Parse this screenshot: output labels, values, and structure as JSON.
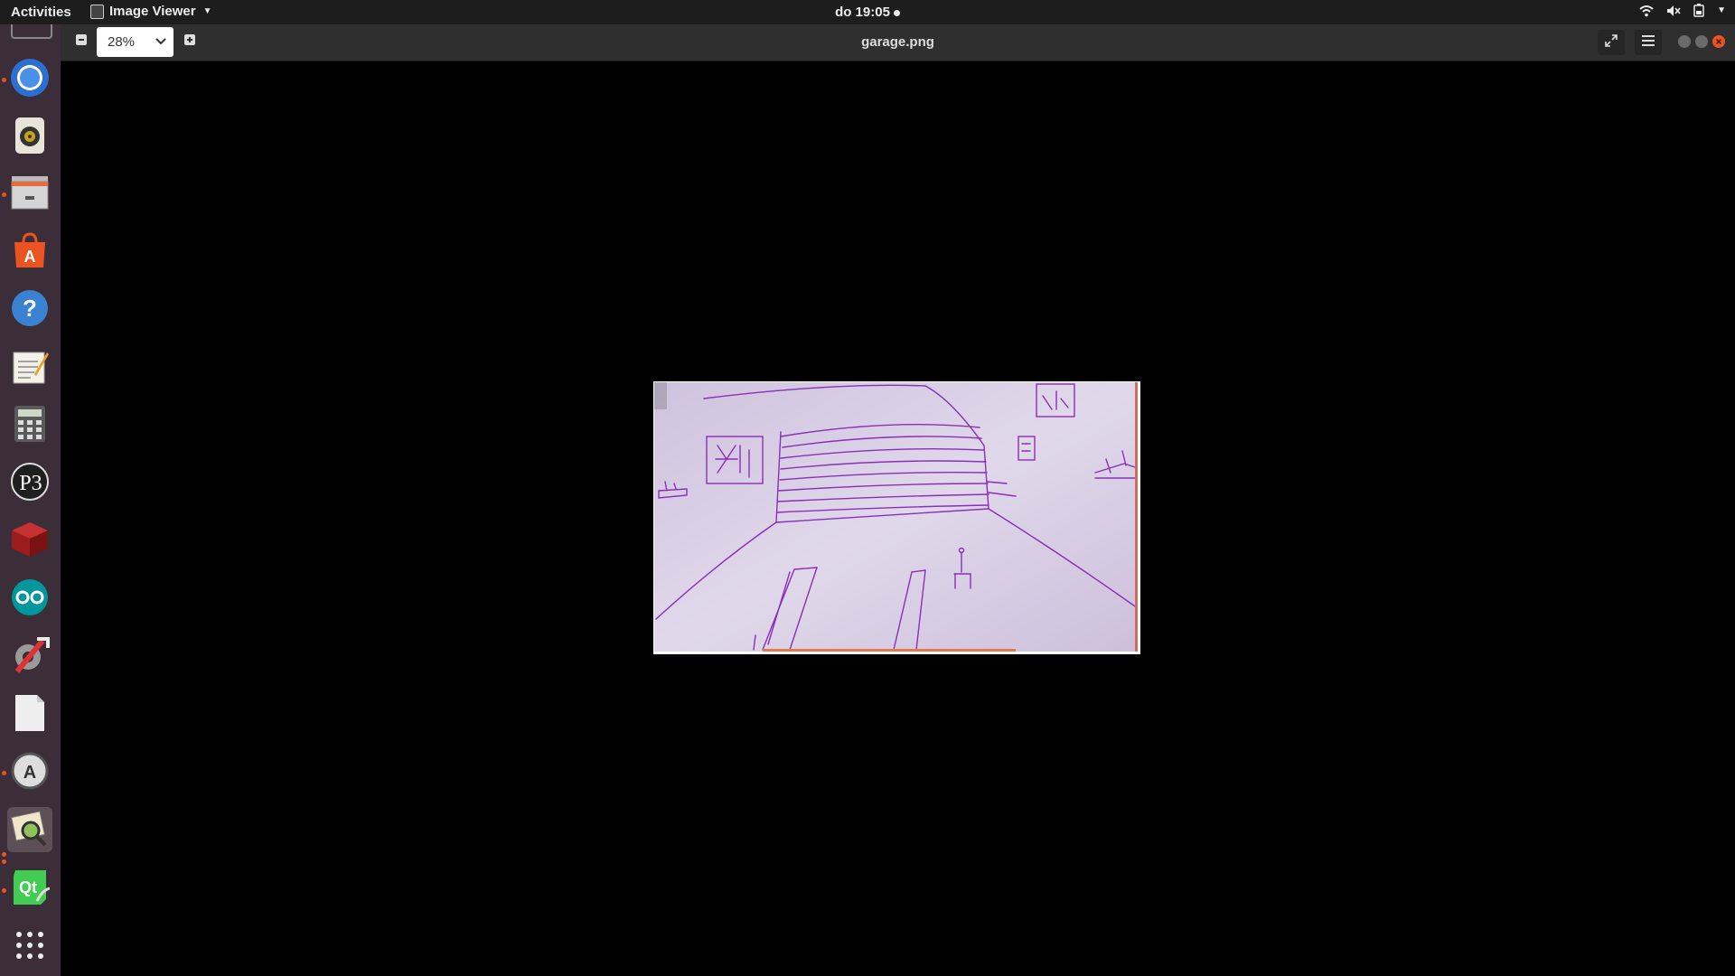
{
  "topbar": {
    "activities": "Activities",
    "app_name": "Image Viewer",
    "app_icon": "image-viewer-icon",
    "clock": "do 19:05",
    "tray": [
      "wifi-icon",
      "volume-icon",
      "battery-icon",
      "system-menu-caret-icon"
    ]
  },
  "dock": {
    "items": [
      {
        "name": "chromium-icon",
        "running": true
      },
      {
        "name": "rhythmbox-icon",
        "running": false
      },
      {
        "name": "files-icon",
        "running": true
      },
      {
        "name": "ubuntu-software-icon",
        "running": false
      },
      {
        "name": "help-icon",
        "running": false
      },
      {
        "name": "text-editor-icon",
        "running": false
      },
      {
        "name": "calculator-icon",
        "running": false
      },
      {
        "name": "processing-icon",
        "running": false
      },
      {
        "name": "3d-box-icon",
        "running": false
      },
      {
        "name": "arduino-icon",
        "running": false
      },
      {
        "name": "system-tools-icon",
        "running": false
      },
      {
        "name": "document-icon",
        "running": false
      },
      {
        "name": "software-updater-icon",
        "running": true
      },
      {
        "name": "image-viewer-icon",
        "running": true,
        "active": true
      },
      {
        "name": "qt-creator-icon",
        "running": true
      },
      {
        "name": "show-applications-icon",
        "running": false
      }
    ]
  },
  "window": {
    "title": "garage.png",
    "zoom": "28%",
    "zoom_out_icon": "zoom-out-icon",
    "zoom_in_icon": "zoom-in-icon",
    "fullscreen_icon": "fullscreen-icon",
    "menu_icon": "hamburger-menu-icon"
  },
  "image": {
    "description_icon": "garage-sketch-image"
  },
  "colors": {
    "topbar": "#1d1d1d",
    "dock": "#3b2e38",
    "header": "#2f2f2f",
    "accent": "#e95420",
    "sketch_ink": "#8a2fb8",
    "paper": "#d9cfe6"
  }
}
